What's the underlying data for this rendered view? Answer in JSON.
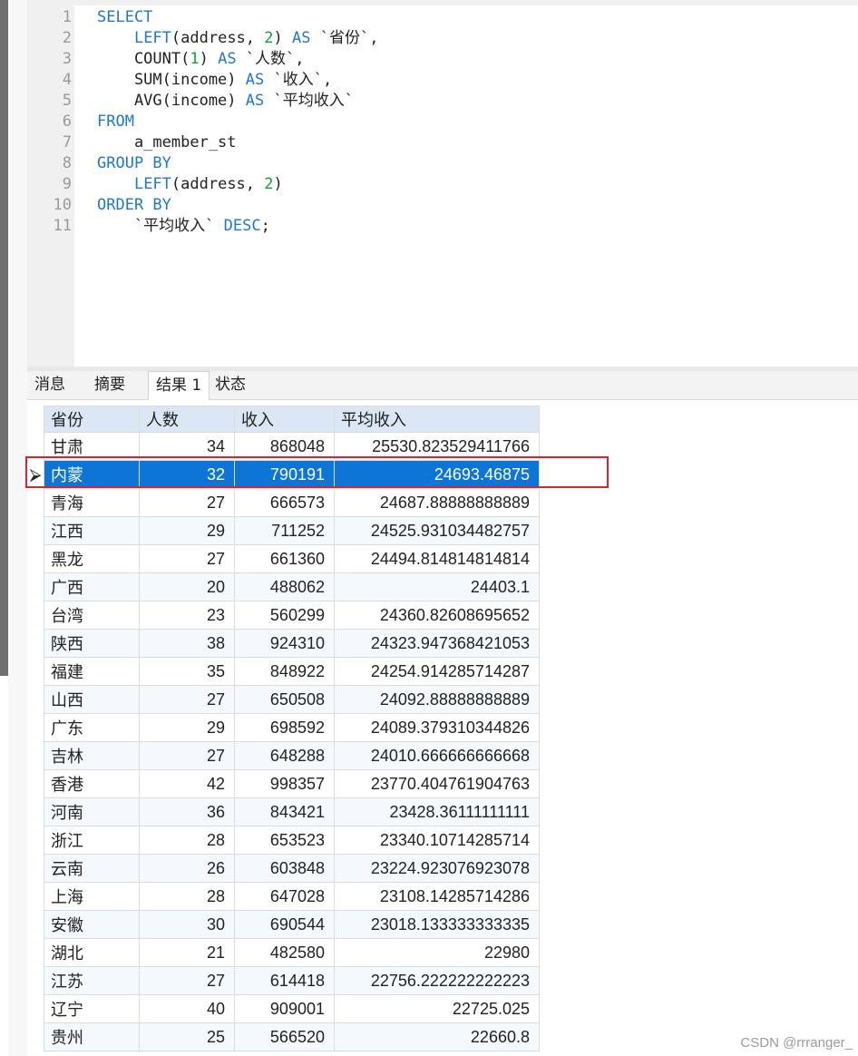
{
  "editor": {
    "lines": [
      {
        "n": "1",
        "parts": [
          {
            "t": "SELECT",
            "c": "kw"
          }
        ]
      },
      {
        "n": "2",
        "parts": [
          {
            "t": "    ",
            "c": "tx"
          },
          {
            "t": "LEFT",
            "c": "kw"
          },
          {
            "t": "(address, ",
            "c": "tx"
          },
          {
            "t": "2",
            "c": "num"
          },
          {
            "t": ") ",
            "c": "tx"
          },
          {
            "t": "AS",
            "c": "kw"
          },
          {
            "t": " `省份`,",
            "c": "tx"
          }
        ]
      },
      {
        "n": "3",
        "parts": [
          {
            "t": "    COUNT(",
            "c": "tx"
          },
          {
            "t": "1",
            "c": "num"
          },
          {
            "t": ") ",
            "c": "tx"
          },
          {
            "t": "AS",
            "c": "kw"
          },
          {
            "t": " `人数`,",
            "c": "tx"
          }
        ]
      },
      {
        "n": "4",
        "parts": [
          {
            "t": "    SUM(income) ",
            "c": "tx"
          },
          {
            "t": "AS",
            "c": "kw"
          },
          {
            "t": " `收入`,",
            "c": "tx"
          }
        ]
      },
      {
        "n": "5",
        "parts": [
          {
            "t": "    AVG(income) ",
            "c": "tx"
          },
          {
            "t": "AS",
            "c": "kw"
          },
          {
            "t": " `平均收入`",
            "c": "tx"
          }
        ]
      },
      {
        "n": "6",
        "parts": [
          {
            "t": "FROM",
            "c": "kw"
          }
        ]
      },
      {
        "n": "7",
        "parts": [
          {
            "t": "    a_member_st",
            "c": "tx"
          }
        ]
      },
      {
        "n": "8",
        "parts": [
          {
            "t": "GROUP BY",
            "c": "kw"
          }
        ]
      },
      {
        "n": "9",
        "parts": [
          {
            "t": "    ",
            "c": "tx"
          },
          {
            "t": "LEFT",
            "c": "kw"
          },
          {
            "t": "(address, ",
            "c": "tx"
          },
          {
            "t": "2",
            "c": "num"
          },
          {
            "t": ")",
            "c": "tx"
          }
        ]
      },
      {
        "n": "10",
        "parts": [
          {
            "t": "ORDER BY",
            "c": "kw"
          }
        ]
      },
      {
        "n": "11",
        "parts": [
          {
            "t": "    `平均收入` ",
            "c": "tx"
          },
          {
            "t": "DESC",
            "c": "kw"
          },
          {
            "t": ";",
            "c": "tx"
          }
        ]
      }
    ]
  },
  "tabs": [
    {
      "label": "消息",
      "active": false
    },
    {
      "label": "摘要",
      "active": false
    },
    {
      "label": "结果 1",
      "active": true
    },
    {
      "label": "状态",
      "active": false
    }
  ],
  "grid": {
    "columns": [
      "省份",
      "人数",
      "收入",
      "平均收入"
    ],
    "selected_indicator": "⮚",
    "selected_row": 1,
    "rows": [
      [
        "甘肃",
        "34",
        "868048",
        "25530.823529411766"
      ],
      [
        "内蒙",
        "32",
        "790191",
        "24693.46875"
      ],
      [
        "青海",
        "27",
        "666573",
        "24687.88888888889"
      ],
      [
        "江西",
        "29",
        "711252",
        "24525.931034482757"
      ],
      [
        "黑龙",
        "27",
        "661360",
        "24494.814814814814"
      ],
      [
        "广西",
        "20",
        "488062",
        "24403.1"
      ],
      [
        "台湾",
        "23",
        "560299",
        "24360.82608695652"
      ],
      [
        "陕西",
        "38",
        "924310",
        "24323.947368421053"
      ],
      [
        "福建",
        "35",
        "848922",
        "24254.914285714287"
      ],
      [
        "山西",
        "27",
        "650508",
        "24092.88888888889"
      ],
      [
        "广东",
        "29",
        "698592",
        "24089.379310344826"
      ],
      [
        "吉林",
        "27",
        "648288",
        "24010.666666666668"
      ],
      [
        "香港",
        "42",
        "998357",
        "23770.404761904763"
      ],
      [
        "河南",
        "36",
        "843421",
        "23428.36111111111"
      ],
      [
        "浙江",
        "28",
        "653523",
        "23340.10714285714"
      ],
      [
        "云南",
        "26",
        "603848",
        "23224.923076923078"
      ],
      [
        "上海",
        "28",
        "647028",
        "23108.14285714286"
      ],
      [
        "安徽",
        "30",
        "690544",
        "23018.133333333335"
      ],
      [
        "湖北",
        "21",
        "482580",
        "22980"
      ],
      [
        "江苏",
        "27",
        "614418",
        "22756.222222222223"
      ],
      [
        "辽宁",
        "40",
        "909001",
        "22725.025"
      ],
      [
        "贵州",
        "25",
        "566520",
        "22660.8"
      ]
    ]
  },
  "colors": {
    "keyword": "#1e78d2",
    "number": "#10a33a",
    "selection": "#0d75d6",
    "highlight_box": "#e0202c"
  },
  "watermark": "CSDN @rrranger_"
}
